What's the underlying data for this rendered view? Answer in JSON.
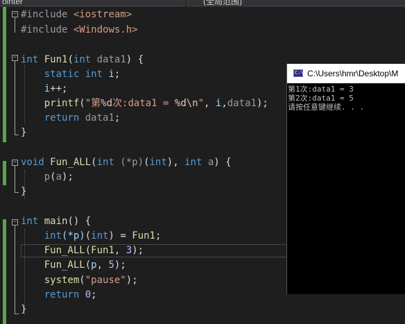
{
  "topbar": {
    "left_dropdown": "ointer",
    "right_dropdown": "(全局范围)"
  },
  "code": {
    "l1": {
      "dir": "#include",
      "hdr": "<iostream>"
    },
    "l2": {
      "dir": "#include",
      "hdr": "<Windows.h>"
    },
    "l4": {
      "kw1": "int",
      "fn": "Fun1",
      "p1": "(",
      "kw2": "int",
      "param": "data1",
      "p2": ")",
      "brace": "{"
    },
    "l5": {
      "kw1": "static",
      "kw2": "int",
      "var": "i",
      "semi": ";"
    },
    "l6": {
      "var": "i",
      "op": "++",
      "semi": ";"
    },
    "l7": {
      "fn": "printf",
      "p1": "(",
      "s1": "\"第",
      "fmt1": "%d",
      "s2": "次:data1 = ",
      "fmt2": "%d",
      "esc": "\\n",
      "s3": "\"",
      "comma": ",",
      "var": "i",
      "comma2": ",",
      "arg": "data1",
      "p2": ")",
      "semi": ";"
    },
    "l8": {
      "kw": "return",
      "var": "data1",
      "semi": ";"
    },
    "l9": {
      "brace": "}"
    },
    "l11": {
      "kw1": "void",
      "fn": "Fun_ALL",
      "p1": "(",
      "kw2": "int",
      "ptr": "(*p)",
      "p2": "(",
      "kw3": "int",
      "p3": "),",
      "kw4": "int",
      "param": "a",
      "p4": ")",
      "brace": "{"
    },
    "l12": {
      "fn": "p",
      "p1": "(",
      "arg": "a",
      "p2": ")",
      "semi": ";"
    },
    "l13": {
      "brace": "}"
    },
    "l15": {
      "kw1": "int",
      "fn": "main",
      "p1": "()",
      "brace": "{"
    },
    "l16": {
      "kw1": "int",
      "ptr": "(*p)",
      "p2": "(",
      "kw2": "int",
      "p3": ")",
      "eq": "=",
      "fn": "Fun1",
      "semi": ";"
    },
    "l17": {
      "fn": "Fun_ALL",
      "p1": "(",
      "arg1": "Fun1",
      "comma": ",",
      "num": "3",
      "p2": ")",
      "semi": ";"
    },
    "l18": {
      "fn": "Fun_ALL",
      "p1": "(",
      "arg1": "p",
      "comma": ",",
      "num": "5",
      "p2": ")",
      "semi": ";"
    },
    "l19": {
      "fn": "system",
      "p1": "(",
      "str": "\"pause\"",
      "p2": ")",
      "semi": ";"
    },
    "l20": {
      "kw": "return",
      "num": "0",
      "semi": ";"
    },
    "l21": {
      "brace": "}"
    }
  },
  "console": {
    "title": "C:\\Users\\hmr\\Desktop\\M",
    "icon_label": "C:\\",
    "lines": [
      "第1次:data1 = 3",
      "第2次:data1 = 5",
      "请按任意键继续. . ."
    ]
  },
  "colors": {
    "keyword": "#569cd6",
    "string": "#d69d85",
    "function": "#dcdcaa",
    "local": "#9cdcfe",
    "change_bar": "#57a64a",
    "editor_bg": "#1e1e1e"
  }
}
